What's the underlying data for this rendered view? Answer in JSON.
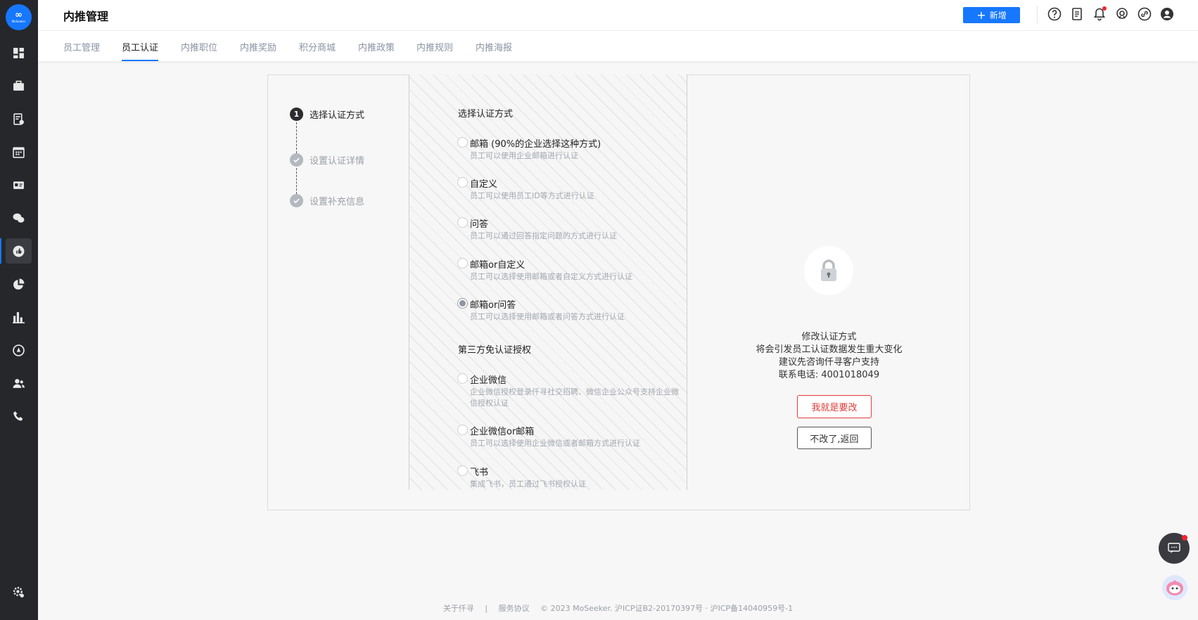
{
  "logo": {
    "mark": "∞",
    "word": "MoSeeker"
  },
  "header": {
    "title": "内推管理",
    "add_button": "新增",
    "colors": {
      "primary": "#1677ff",
      "notification_dot": "#f5222d"
    },
    "icons": [
      "help-icon",
      "document-icon",
      "bell-icon",
      "support-icon",
      "link-icon",
      "user-icon"
    ]
  },
  "tabs": [
    {
      "label": "员工管理"
    },
    {
      "label": "员工认证"
    },
    {
      "label": "内推职位"
    },
    {
      "label": "内推奖励"
    },
    {
      "label": "积分商城"
    },
    {
      "label": "内推政策"
    },
    {
      "label": "内推规则"
    },
    {
      "label": "内推海报"
    }
  ],
  "steps": [
    {
      "num": "1",
      "label": "选择认证方式",
      "state": "active"
    },
    {
      "label": "设置认证详情",
      "state": "done"
    },
    {
      "label": "设置补充信息",
      "state": "done"
    }
  ],
  "auth": {
    "section1_title": "选择认证方式",
    "options": [
      {
        "name": "邮箱 (90%的企业选择这种方式)",
        "desc": "员工可以使用企业邮箱进行认证",
        "checked": false
      },
      {
        "name": "自定义",
        "desc": "员工可以使用员工ID等方式进行认证",
        "checked": false
      },
      {
        "name": "问答",
        "desc": "员工可以通过回答指定问题的方式进行认证",
        "checked": false
      },
      {
        "name": "邮箱or自定义",
        "desc": "员工可以选择使用邮箱或者自定义方式进行认证",
        "checked": false
      },
      {
        "name": "邮箱or问答",
        "desc": "员工可以选择使用邮箱或者问答方式进行认证",
        "checked": true
      }
    ],
    "section2_title": "第三方免认证授权",
    "third_party": [
      {
        "name": "企业微信",
        "desc": "企业微信授权登录仟寻社交招聘、微信企业公众号支持企业微信授权认证",
        "checked": false
      },
      {
        "name": "企业微信or邮箱",
        "desc": "员工可以选择使用企业微信或者邮箱方式进行认证",
        "checked": false
      },
      {
        "name": "飞书",
        "desc": "集成飞书，员工通过飞书授权认证",
        "checked": false
      }
    ]
  },
  "lock_panel": {
    "line1": "修改认证方式",
    "line2": "将会引发员工认证数据发生重大变化",
    "line3": "建议先咨询仟寻客户支持",
    "line4": "联系电话: 4001018049",
    "confirm_button": "我就是要改",
    "back_button": "不改了,返回"
  },
  "footer": {
    "about": "关于仟寻",
    "sep": "|",
    "terms": "服务协议",
    "copyright": "© 2023 MoSeeker. 沪ICP证B2-20170397号 · 沪ICP备14040959号-1"
  }
}
